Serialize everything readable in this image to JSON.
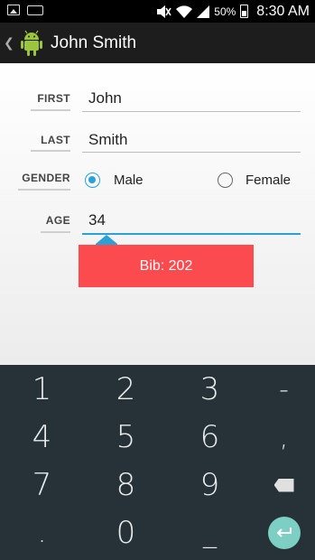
{
  "status_bar": {
    "battery": "50%",
    "time": "8:30 AM"
  },
  "action_bar": {
    "back": "❮",
    "title": "John Smith"
  },
  "form": {
    "first": {
      "label": "FIRST",
      "value": "John"
    },
    "last": {
      "label": "LAST",
      "value": "Smith"
    },
    "gender": {
      "label": "GENDER",
      "options": [
        "Male",
        "Female"
      ],
      "selected": "Male"
    },
    "age": {
      "label": "AGE",
      "value": "34"
    },
    "bib": "Bib: 202"
  },
  "keyboard": {
    "rows": [
      [
        "1",
        "2",
        "3",
        "-"
      ],
      [
        "4",
        "5",
        "6",
        ","
      ],
      [
        "7",
        "8",
        "9",
        "backspace"
      ],
      [
        ".",
        "0",
        "_",
        "enter"
      ]
    ]
  },
  "colors": {
    "accent": "#2ba1d8",
    "bib_background": "#fb4b4e",
    "keyboard_background": "#263238",
    "enter_key": "#7dcfc3"
  },
  "icons": {
    "status_left": [
      "image-icon",
      "keyboard-icon"
    ],
    "status_right": [
      "mute-icon",
      "wifi-icon",
      "signal-icon",
      "battery-icon"
    ],
    "app": "android-icon"
  }
}
